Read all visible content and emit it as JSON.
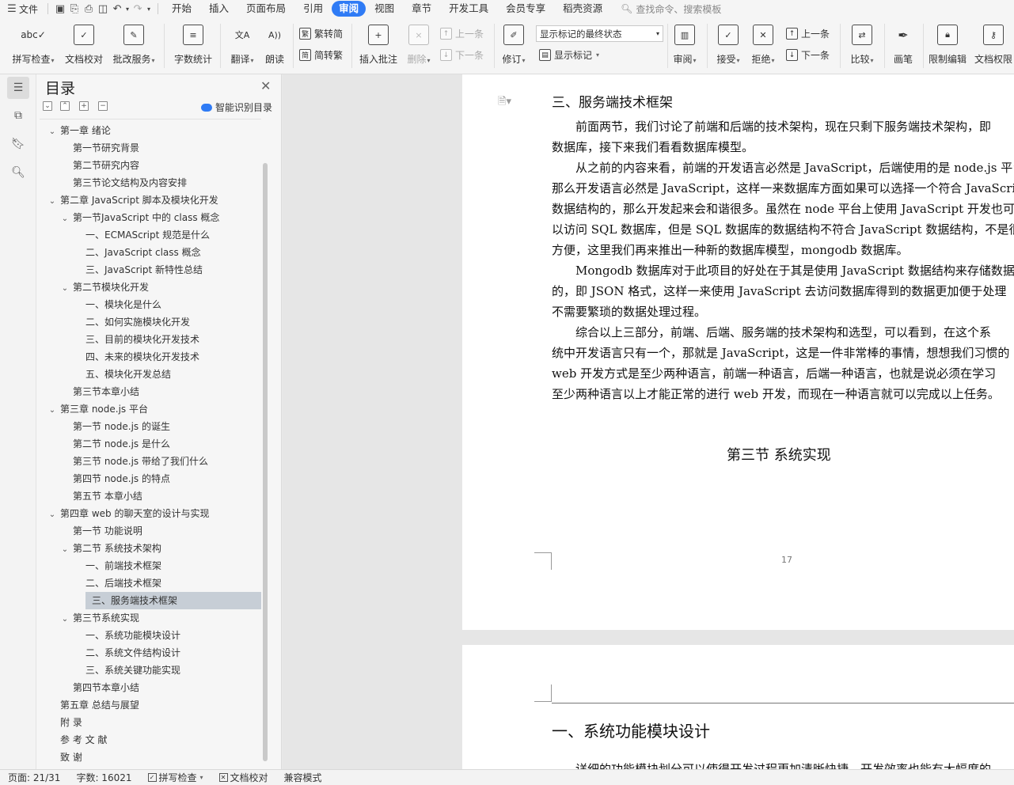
{
  "menubar": {
    "file_label": "文件",
    "tabs": [
      "开始",
      "插入",
      "页面布局",
      "引用",
      "审阅",
      "视图",
      "章节",
      "开发工具",
      "会员专享",
      "稻壳资源"
    ],
    "active_tab": "审阅",
    "search_placeholder": "查找命令、搜索模板"
  },
  "ribbon": {
    "spellcheck": "拼写检查",
    "doc_proof": "文档校对",
    "batch_service": "批改服务",
    "word_count": "字数统计",
    "translate": "翻译",
    "read_aloud": "朗读",
    "trad_simp": "繁转简",
    "simp_trad": "简转繁",
    "insert_comment": "插入批注",
    "delete": "删除",
    "prev_comment": "上一条",
    "next_comment": "下一条",
    "revise": "修订",
    "show_markup_select": "显示标记的最终状态",
    "show_markup": "显示标记",
    "review": "审阅",
    "accept": "接受",
    "reject": "拒绝",
    "prev_change": "上一条",
    "next_change": "下一条",
    "compare": "比较",
    "pen": "画笔",
    "restrict_edit": "限制编辑",
    "doc_permission": "文档权限"
  },
  "toc": {
    "title": "目录",
    "ai_label": "智能识别目录",
    "items": [
      {
        "text": "第一章  绪论",
        "level": 0,
        "twisty": "v"
      },
      {
        "text": "第一节研究背景",
        "level": 1,
        "twisty": ""
      },
      {
        "text": "第二节研究内容",
        "level": 1,
        "twisty": ""
      },
      {
        "text": "第三节论文结构及内容安排",
        "level": 1,
        "twisty": ""
      },
      {
        "text": "第二章   JavaScript 脚本及模块化开发",
        "level": 0,
        "twisty": "v"
      },
      {
        "text": "第一节JavaScript 中的 class 概念",
        "level": 1,
        "twisty": "v"
      },
      {
        "text": "一、ECMAScript 规范是什么",
        "level": 2,
        "twisty": ""
      },
      {
        "text": "二、JavaScript class 概念",
        "level": 2,
        "twisty": ""
      },
      {
        "text": "三、JavaScript 新特性总结",
        "level": 2,
        "twisty": ""
      },
      {
        "text": "第二节模块化开发",
        "level": 1,
        "twisty": "v"
      },
      {
        "text": "一、模块化是什么",
        "level": 2,
        "twisty": ""
      },
      {
        "text": "二、如何实施模块化开发",
        "level": 2,
        "twisty": ""
      },
      {
        "text": "三、目前的模块化开发技术",
        "level": 2,
        "twisty": ""
      },
      {
        "text": "四、未来的模块化开发技术",
        "level": 2,
        "twisty": ""
      },
      {
        "text": "五、模块化开发总结",
        "level": 2,
        "twisty": ""
      },
      {
        "text": "第三节本章小结",
        "level": 1,
        "twisty": ""
      },
      {
        "text": "第三章    node.js 平台",
        "level": 0,
        "twisty": "v"
      },
      {
        "text": "第一节  node.js 的诞生",
        "level": 1,
        "twisty": ""
      },
      {
        "text": "第二节  node.js 是什么",
        "level": 1,
        "twisty": ""
      },
      {
        "text": "第三节  node.js 带给了我们什么",
        "level": 1,
        "twisty": ""
      },
      {
        "text": "第四节  node.js 的特点",
        "level": 1,
        "twisty": ""
      },
      {
        "text": "第五节  本章小结",
        "level": 1,
        "twisty": ""
      },
      {
        "text": "第四章    web 的聊天室的设计与实现",
        "level": 0,
        "twisty": "v"
      },
      {
        "text": "第一节  功能说明",
        "level": 1,
        "twisty": ""
      },
      {
        "text": "第二节  系统技术架构",
        "level": 1,
        "twisty": "v"
      },
      {
        "text": "一、前端技术框架",
        "level": 2,
        "twisty": ""
      },
      {
        "text": "二、后端技术框架",
        "level": 2,
        "twisty": ""
      },
      {
        "text": "三、服务端技术框架",
        "level": 2,
        "twisty": "",
        "selected": true
      },
      {
        "text": "第三节系统实现",
        "level": 1,
        "twisty": "v"
      },
      {
        "text": "一、系统功能模块设计",
        "level": 2,
        "twisty": ""
      },
      {
        "text": "二、系统文件结构设计",
        "level": 2,
        "twisty": ""
      },
      {
        "text": "三、系统关键功能实现",
        "level": 2,
        "twisty": ""
      },
      {
        "text": "第四节本章小结",
        "level": 1,
        "twisty": ""
      },
      {
        "text": "第五章    总结与展望",
        "level": 0,
        "twisty": ""
      },
      {
        "text": "附    录",
        "level": 0,
        "twisty": ""
      },
      {
        "text": "参 考 文 献",
        "level": 0,
        "twisty": ""
      },
      {
        "text": "致    谢",
        "level": 0,
        "twisty": ""
      }
    ]
  },
  "document": {
    "heading_server": "三、服务端技术框架",
    "paragraphs": [
      "前面两节，我们讨论了前端和后端的技术架构，现在只剩下服务端技术架构，即",
      "数据库，接下来我们看看数据库模型。",
      "从之前的内容来看，前端的开发语言必然是 JavaScript，后端使用的是 node.js 平台",
      "那么开发语言必然是 JavaScript，这样一来数据库方面如果可以选择一个符合 JavaScrip",
      "数据结构的，那么开发起来会和谐很多。虽然在 node 平台上使用 JavaScript 开发也可",
      "以访问 SQL 数据库，但是 SQL 数据库的数据结构不符合 JavaScript 数据结构，不是很",
      "方便，这里我们再来推出一种新的数据库模型，mongodb 数据库。",
      "Mongodb 数据库对于此项目的好处在于其是使用 JavaScript 数据结构来存储数据",
      "的，即 JSON 格式，这样一来使用 JavaScript 去访问数据库得到的数据更加便于处理",
      "不需要繁琐的数据处理过程。",
      "综合以上三部分，前端、后端、服务端的技术架构和选型，可以看到，在这个系",
      "统中开发语言只有一个，那就是 JavaScript，这是一件非常棒的事情，想想我们习惯的",
      "web 开发方式是至少两种语言，前端一种语言，后端一种语言，也就是说必须在学习",
      "至少两种语言以上才能正常的进行 web 开发，而现在一种语言就可以完成以上任务。"
    ],
    "section_title": "第三节  系统实现",
    "page_number": "17",
    "heading_module": "一、系统功能模块设计",
    "cut_line": "详细的功能模块划分可以使得开发过程更加清晰快捷，开发效率也能有大幅度的"
  },
  "statusbar": {
    "page": "页面: 21/31",
    "words": "字数: 16021",
    "spellcheck": "拼写检查",
    "doc_proof": "文档校对",
    "compat_mode": "兼容模式"
  }
}
